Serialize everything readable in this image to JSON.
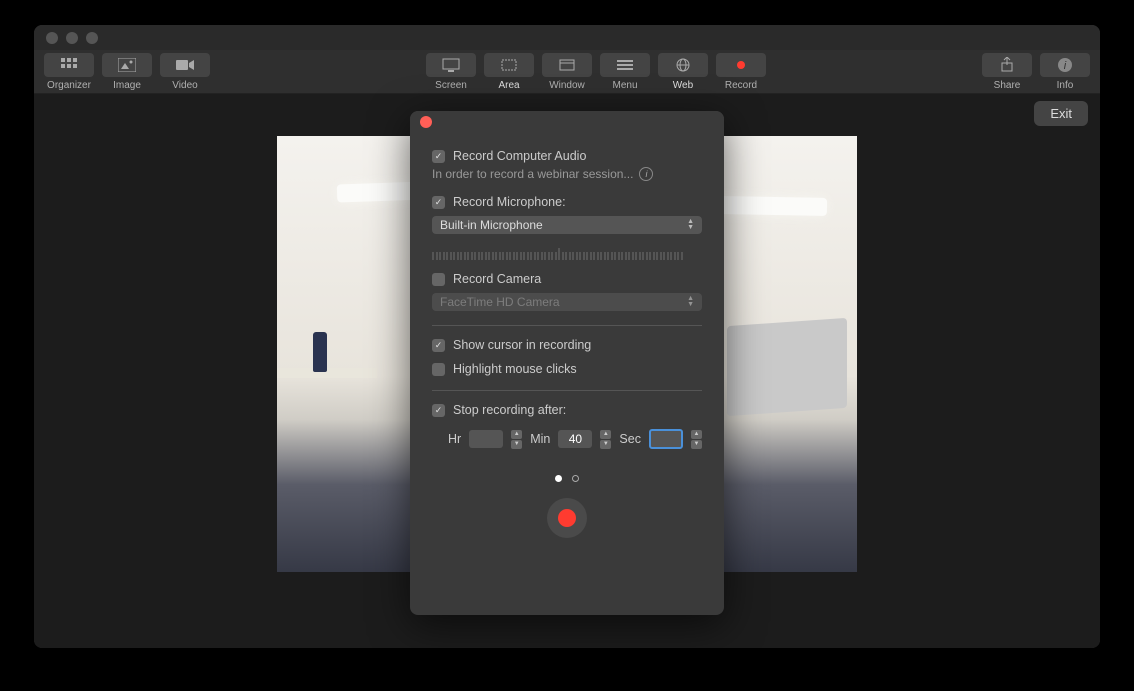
{
  "toolbar": {
    "left": [
      {
        "id": "organizer",
        "label": "Organizer"
      },
      {
        "id": "image",
        "label": "Image"
      },
      {
        "id": "video",
        "label": "Video"
      }
    ],
    "center": [
      {
        "id": "screen",
        "label": "Screen"
      },
      {
        "id": "area",
        "label": "Area"
      },
      {
        "id": "window",
        "label": "Window"
      },
      {
        "id": "menu",
        "label": "Menu"
      },
      {
        "id": "web",
        "label": "Web"
      },
      {
        "id": "record",
        "label": "Record"
      }
    ],
    "right": [
      {
        "id": "share",
        "label": "Share"
      },
      {
        "id": "info",
        "label": "Info"
      }
    ]
  },
  "exit_label": "Exit",
  "popup": {
    "record_computer_audio": {
      "checked": true,
      "label": "Record Computer Audio",
      "hint": "In order to record a webinar session..."
    },
    "record_microphone": {
      "checked": true,
      "label": "Record Microphone:",
      "selected": "Built-in Microphone"
    },
    "record_camera": {
      "checked": false,
      "label": "Record Camera",
      "selected": "FaceTime HD Camera"
    },
    "show_cursor": {
      "checked": true,
      "label": "Show cursor in recording"
    },
    "highlight_clicks": {
      "checked": false,
      "label": "Highlight mouse clicks"
    },
    "stop_after": {
      "checked": true,
      "label": "Stop recording after:"
    },
    "time": {
      "hr_label": "Hr",
      "hr_value": "",
      "min_label": "Min",
      "min_value": "40",
      "sec_label": "Sec",
      "sec_value": ""
    }
  }
}
